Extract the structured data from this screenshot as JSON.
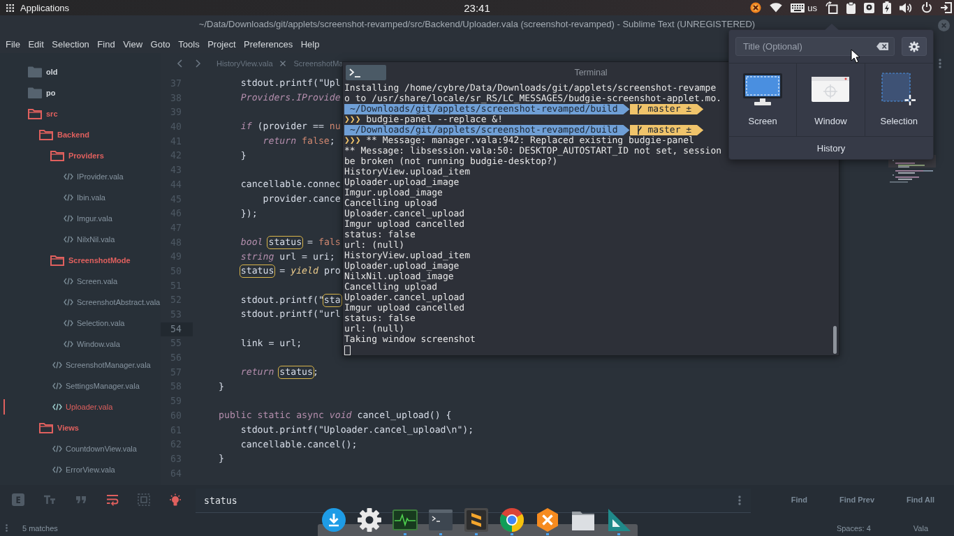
{
  "top_panel": {
    "menu_label": "Applications",
    "clock": "23:41",
    "keyboard_layout": "us"
  },
  "window": {
    "title": "~/Data/Downloads/git/applets/screenshot-revamped/src/Backend/Uploader.vala (screenshot-revamped) - Sublime Text (UNREGISTERED)"
  },
  "menu": [
    "File",
    "Edit",
    "Selection",
    "Find",
    "View",
    "Goto",
    "Tools",
    "Project",
    "Preferences",
    "Help"
  ],
  "sidebar": {
    "items": [
      {
        "name": "old",
        "kind": "folder",
        "expanded": false,
        "selected": false
      },
      {
        "name": "po",
        "kind": "folder",
        "expanded": false,
        "selected": false
      },
      {
        "name": "src",
        "kind": "folder",
        "expanded": true,
        "selected": false,
        "children": [
          {
            "name": "Backend",
            "kind": "folder",
            "expanded": true,
            "selected": false,
            "children": [
              {
                "name": "Providers",
                "kind": "folder",
                "expanded": true,
                "selected": false,
                "children": [
                  {
                    "name": "IProvider.vala",
                    "kind": "file",
                    "selected": false
                  },
                  {
                    "name": "Ibin.vala",
                    "kind": "file",
                    "selected": false
                  },
                  {
                    "name": "Imgur.vala",
                    "kind": "file",
                    "selected": false
                  },
                  {
                    "name": "NilxNil.vala",
                    "kind": "file",
                    "selected": false
                  }
                ]
              },
              {
                "name": "ScreenshotMode",
                "kind": "folder",
                "expanded": true,
                "selected": false,
                "children": [
                  {
                    "name": "Screen.vala",
                    "kind": "file",
                    "selected": false
                  },
                  {
                    "name": "ScreenshotAbstract.vala",
                    "kind": "file",
                    "selected": false
                  },
                  {
                    "name": "Selection.vala",
                    "kind": "file",
                    "selected": false
                  },
                  {
                    "name": "Window.vala",
                    "kind": "file",
                    "selected": false
                  }
                ]
              },
              {
                "name": "ScreenshotManager.vala",
                "kind": "file",
                "selected": false
              },
              {
                "name": "SettingsManager.vala",
                "kind": "file",
                "selected": false
              },
              {
                "name": "Uploader.vala",
                "kind": "file",
                "selected": true
              }
            ]
          },
          {
            "name": "Views",
            "kind": "folder",
            "expanded": true,
            "selected": false,
            "children": [
              {
                "name": "CountdownView.vala",
                "kind": "file",
                "selected": false
              },
              {
                "name": "ErrorView.vala",
                "kind": "file",
                "selected": false
              }
            ]
          }
        ]
      }
    ]
  },
  "tabs": [
    {
      "label": "HistoryView.vala",
      "selected": false,
      "close_button": true
    },
    {
      "label": "ScreenshotMa",
      "selected": false,
      "close_button": false
    }
  ],
  "editor": {
    "lines": [
      {
        "number": "37",
        "current": false,
        "tokens": [
          {
            "kind": "plain",
            "text": "    stdout.printf(\"Upl"
          }
        ]
      },
      {
        "number": "38",
        "current": false,
        "tokens": [
          {
            "kind": "type",
            "text": "    Providers.IProvide"
          }
        ]
      },
      {
        "number": "39",
        "current": false
      },
      {
        "number": "40",
        "current": false,
        "tokens": [
          {
            "kind": "keyword",
            "text": "    if"
          },
          {
            "kind": "plain",
            "text": " (provider == "
          },
          {
            "kind": "constant",
            "text": "nu"
          }
        ]
      },
      {
        "number": "41",
        "current": false,
        "tokens": [
          {
            "kind": "keyword",
            "text": "        return "
          },
          {
            "kind": "constant",
            "text": "false"
          },
          {
            "kind": "plain",
            "text": ";"
          }
        ]
      },
      {
        "number": "42",
        "current": false,
        "tokens": [
          {
            "kind": "plain",
            "text": "    }"
          }
        ]
      },
      {
        "number": "43",
        "current": false
      },
      {
        "number": "44",
        "current": false,
        "tokens": [
          {
            "kind": "plain",
            "text": "    cancellable.connec"
          }
        ]
      },
      {
        "number": "45",
        "current": false,
        "tokens": [
          {
            "kind": "plain",
            "text": "        provider.cance"
          }
        ]
      },
      {
        "number": "46",
        "current": false,
        "tokens": [
          {
            "kind": "plain",
            "text": "    });"
          }
        ]
      },
      {
        "number": "47",
        "current": false
      },
      {
        "number": "48",
        "current": false,
        "tokens": [
          {
            "kind": "keyword",
            "text": "    bool "
          },
          {
            "kind": "match",
            "text": "status"
          },
          {
            "kind": "plain",
            "text": " = "
          },
          {
            "kind": "constant",
            "text": "fals"
          }
        ]
      },
      {
        "number": "49",
        "current": false,
        "tokens": [
          {
            "kind": "keyword",
            "text": "    string"
          },
          {
            "kind": "plain",
            "text": " url = uri;"
          }
        ]
      },
      {
        "number": "50",
        "current": false,
        "tokens": [
          {
            "kind": "match",
            "text": "    status"
          },
          {
            "kind": "plain",
            "text": " = "
          },
          {
            "kind": "storage",
            "text": "yield"
          },
          {
            "kind": "plain",
            "text": " pro"
          }
        ]
      },
      {
        "number": "51",
        "current": false
      },
      {
        "number": "52",
        "current": false,
        "tokens": [
          {
            "kind": "plain",
            "text": "    stdout.printf(\""
          },
          {
            "kind": "match",
            "text": "sta"
          }
        ]
      },
      {
        "number": "53",
        "current": false,
        "tokens": [
          {
            "kind": "plain",
            "text": "    stdout.printf(\"url"
          }
        ]
      },
      {
        "number": "54",
        "current": true
      },
      {
        "number": "55",
        "current": false,
        "tokens": [
          {
            "kind": "plain",
            "text": "    link = url;"
          }
        ]
      },
      {
        "number": "56",
        "current": false
      },
      {
        "number": "57",
        "current": false,
        "tokens": [
          {
            "kind": "keyword",
            "text": "    return "
          },
          {
            "kind": "match",
            "text": "status"
          },
          {
            "kind": "plain",
            "text": ";"
          }
        ]
      },
      {
        "number": "58",
        "current": false,
        "tokens": [
          {
            "kind": "plain",
            "text": "}"
          }
        ]
      },
      {
        "number": "59",
        "current": false
      },
      {
        "number": "60",
        "current": false,
        "tokens": [
          {
            "kind": "modifier",
            "text": "public static async "
          },
          {
            "kind": "keyword",
            "text": "void"
          },
          {
            "kind": "plain",
            "text": " cancel_upload() {"
          }
        ]
      },
      {
        "number": "61",
        "current": false,
        "tokens": [
          {
            "kind": "plain",
            "text": "    stdout.printf(\"Uploader.cancel_upload\\n\");"
          }
        ]
      },
      {
        "number": "62",
        "current": false,
        "tokens": [
          {
            "kind": "plain",
            "text": "    cancellable.cancel();"
          }
        ]
      },
      {
        "number": "63",
        "current": false,
        "tokens": [
          {
            "kind": "plain",
            "text": "}"
          }
        ]
      },
      {
        "number": "64",
        "current": false
      }
    ]
  },
  "terminal": {
    "title": "Terminal",
    "lines": [
      {
        "kind": "output",
        "text": "Installing /home/cybre/Data/Downloads/git/applets/screenshot-revampe"
      },
      {
        "kind": "output",
        "text": "o to /usr/share/locale/sr_RS/LC_MESSAGES/budgie-screenshot-applet.mo."
      },
      {
        "kind": "prompt",
        "path": "~/Downloads/git/applets/screenshot-revamped/build",
        "branch": "master ±"
      },
      {
        "kind": "command",
        "prompt": "❯❯❯",
        "text": "budgie-panel --replace &!"
      },
      {
        "kind": "prompt",
        "path": "~/Downloads/git/applets/screenshot-revamped/build",
        "branch": "master ±"
      },
      {
        "kind": "command",
        "prompt": "❯❯❯",
        "text": "** Message: manager.vala:942: Replaced existing budgie-panel"
      },
      {
        "kind": "output",
        "text": "** Message: libsession.vala:50: DESKTOP_AUTOSTART_ID not set, session"
      },
      {
        "kind": "output",
        "text": "be broken (not running budgie-desktop?)"
      },
      {
        "kind": "output",
        "text": "HistoryView.upload_item"
      },
      {
        "kind": "output",
        "text": "Uploader.upload_image"
      },
      {
        "kind": "output",
        "text": "Imgur.upload_image"
      },
      {
        "kind": "output",
        "text": "Cancelling upload"
      },
      {
        "kind": "output",
        "text": "Uploader.cancel_upload"
      },
      {
        "kind": "output",
        "text": "Imgur upload cancelled"
      },
      {
        "kind": "output",
        "text": "status: false"
      },
      {
        "kind": "output",
        "text": "url: (null)"
      },
      {
        "kind": "output",
        "text": "HistoryView.upload_item"
      },
      {
        "kind": "output",
        "text": "Uploader.upload_image"
      },
      {
        "kind": "output",
        "text": "NilxNil.upload_image"
      },
      {
        "kind": "output",
        "text": "Cancelling upload"
      },
      {
        "kind": "output",
        "text": "Uploader.cancel_upload"
      },
      {
        "kind": "output",
        "text": "Imgur upload cancelled"
      },
      {
        "kind": "output",
        "text": "status: false"
      },
      {
        "kind": "output",
        "text": "url: (null)"
      },
      {
        "kind": "output",
        "text": "Taking window screenshot"
      },
      {
        "kind": "cursor"
      }
    ]
  },
  "screenshot_popup": {
    "title_field": {
      "placeholder": "Title (Optional)"
    },
    "modes": [
      {
        "kind": "screen",
        "label": "Screen"
      },
      {
        "kind": "window",
        "label": "Window"
      },
      {
        "kind": "selection",
        "label": "Selection"
      }
    ],
    "history": "History"
  },
  "find_panel": {
    "options": [
      {
        "kind": "regex",
        "on": false
      },
      {
        "kind": "case",
        "on": false
      },
      {
        "kind": "word",
        "on": false
      },
      {
        "kind": "wrap",
        "on": true
      },
      {
        "kind": "selection",
        "on": false
      },
      {
        "kind": "highlight",
        "on": true
      }
    ],
    "query": "status",
    "buttons": [
      "Find",
      "Find Prev",
      "Find All"
    ]
  },
  "status_bar": {
    "matches": "5 matches",
    "indentation": "Spaces: 4",
    "syntax": "Vala"
  },
  "dock": {
    "items": [
      {
        "kind": "download",
        "running": false
      },
      {
        "kind": "settings",
        "running": false
      },
      {
        "kind": "monitor",
        "running": true
      },
      {
        "kind": "terminal",
        "running": true
      },
      {
        "kind": "editor",
        "running": true
      },
      {
        "kind": "browser",
        "running": true
      },
      {
        "kind": "hexagon",
        "running": true
      },
      {
        "kind": "files",
        "running": false
      },
      {
        "kind": "geometry",
        "running": true
      }
    ]
  }
}
